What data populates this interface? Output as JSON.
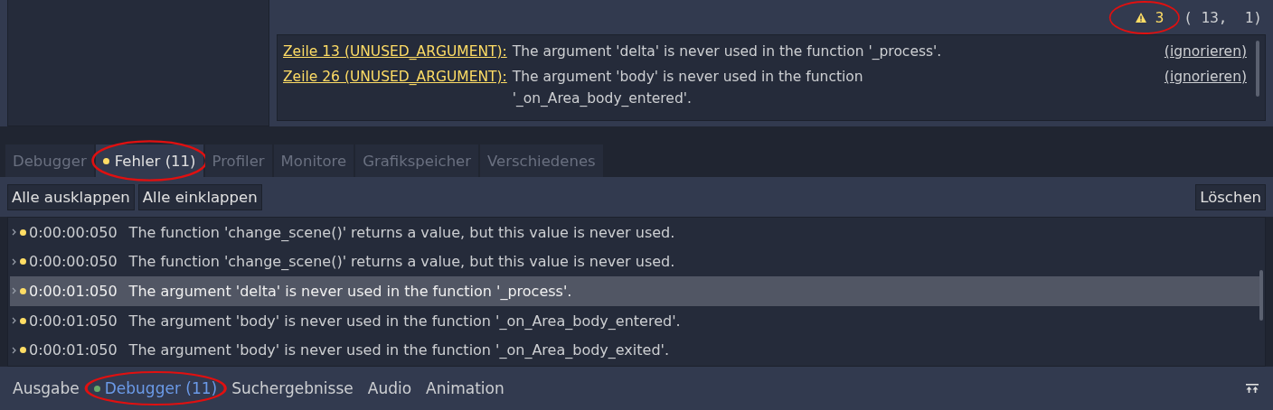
{
  "status": {
    "warning_count": "3",
    "highlighted": true,
    "position": "( 13,  1)"
  },
  "warnings": [
    {
      "location": "Zeile 13 (UNUSED_ARGUMENT):",
      "message": "The argument 'delta' is never used in the function '_process'.",
      "action": "(ignorieren)"
    },
    {
      "location": "Zeile 26 (UNUSED_ARGUMENT):",
      "message": "The argument 'body' is never used in the function '_on_Area_body_entered'.",
      "action": "(ignorieren)"
    }
  ],
  "debugger_tabs": [
    {
      "label": "Debugger",
      "selected": false,
      "dot": false,
      "highlighted": false
    },
    {
      "label": "Fehler (11)",
      "selected": true,
      "dot": true,
      "highlighted": true
    },
    {
      "label": "Profiler",
      "selected": false,
      "dot": false,
      "highlighted": false
    },
    {
      "label": "Monitore",
      "selected": false,
      "dot": false,
      "highlighted": false
    },
    {
      "label": "Grafikspeicher",
      "selected": false,
      "dot": false,
      "highlighted": false
    },
    {
      "label": "Verschiedenes",
      "selected": false,
      "dot": false,
      "highlighted": false
    }
  ],
  "toolbar": {
    "left_buttons": [
      "Alle ausklappen",
      "Alle einklappen"
    ],
    "right_button": "Löschen"
  },
  "log": [
    {
      "time": "0:00:00:050",
      "message": "The function 'change_scene()' returns a value, but this value is never used.",
      "selected": false
    },
    {
      "time": "0:00:00:050",
      "message": "The function 'change_scene()' returns a value, but this value is never used.",
      "selected": false
    },
    {
      "time": "0:00:01:050",
      "message": "The argument 'delta' is never used in the function '_process'.",
      "selected": true
    },
    {
      "time": "0:00:01:050",
      "message": "The argument 'body' is never used in the function '_on_Area_body_entered'.",
      "selected": false
    },
    {
      "time": "0:00:01:050",
      "message": "The argument 'body' is never used in the function '_on_Area_body_exited'.",
      "selected": false
    }
  ],
  "bottom_tabs": [
    {
      "label": "Ausgabe",
      "selected": false,
      "dot": false,
      "highlighted": false
    },
    {
      "label": "Debugger (11)",
      "selected": true,
      "dot": true,
      "highlighted": true
    },
    {
      "label": "Suchergebnisse",
      "selected": false,
      "dot": false,
      "highlighted": false
    },
    {
      "label": "Audio",
      "selected": false,
      "dot": false,
      "highlighted": false
    },
    {
      "label": "Animation",
      "selected": false,
      "dot": false,
      "highlighted": false
    }
  ]
}
